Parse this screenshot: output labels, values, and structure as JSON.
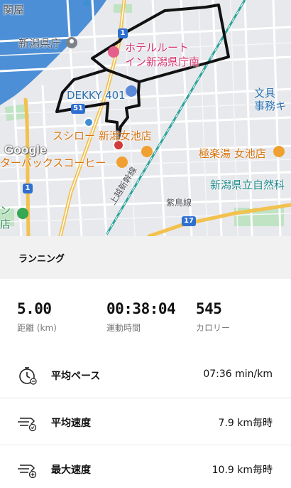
{
  "map": {
    "labels": {
      "niigata_pref_office": "新潟県庁",
      "hotel_line1": "ホテルルート",
      "hotel_line2": "イン新潟県庁南",
      "dekky": "DEKKY 401",
      "sushiro": "スシロー 新潟女池店",
      "starbucks": "ターバックスコーヒー",
      "gokurakuyu": "極楽湯 女池店",
      "science_museum": "新潟県立自然科",
      "bunkyo_line1": "文具",
      "bunkyo_line2": "事務キ",
      "sekiya": "関屋",
      "joetsu_shinkansen": "上越新幹線",
      "hakushin_line": "紫鳥線",
      "left_fragment1": "ン",
      "left_fragment2": "店"
    },
    "road_badges": {
      "r1_top": "1",
      "r51": "51",
      "r1_bottom": "1",
      "r17": "17"
    },
    "google_logo": "Google"
  },
  "section": {
    "title": "ランニング"
  },
  "stats": [
    {
      "value": "5.00",
      "label": "距離 (km)"
    },
    {
      "value": "00:38:04",
      "label": "運動時間"
    },
    {
      "value": "545",
      "label": "カロリー"
    }
  ],
  "metrics": [
    {
      "icon": "stopwatch-icon",
      "name": "平均ペース",
      "value": "07:36 min/km"
    },
    {
      "icon": "speed-check-icon",
      "name": "平均速度",
      "value": "7.9 km毎時"
    },
    {
      "icon": "speed-plus-icon",
      "name": "最大速度",
      "value": "10.9 km毎時"
    }
  ],
  "colors": {
    "route": "#111111",
    "river": "#4d8fd6",
    "rail": "#2aa39a",
    "highway": "#f2c14e",
    "pin_red": "#d23b3b",
    "pin_blue": "#3f8fd2",
    "section_bg": "#f1f1f2"
  }
}
